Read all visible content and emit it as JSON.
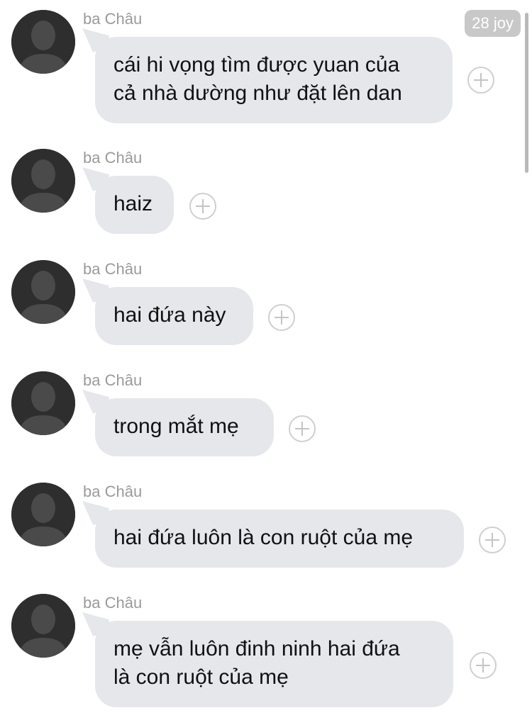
{
  "status": {
    "time_badge": "28 joy"
  },
  "messages": [
    {
      "sender": "ba Châu",
      "text": "cái hi vọng tìm được yuan của\ncả nhà dường như đặt lên dan"
    },
    {
      "sender": "ba Châu",
      "text": "haiz"
    },
    {
      "sender": "ba Châu",
      "text": "hai đứa này"
    },
    {
      "sender": "ba Châu",
      "text": "trong mắt mẹ"
    },
    {
      "sender": "ba Châu",
      "text": "hai đứa luôn là con ruột của mẹ"
    },
    {
      "sender": "ba Châu",
      "text": "mẹ vẫn luôn đinh ninh hai đứa\nlà con ruột của mẹ"
    }
  ],
  "icons": {
    "avatar": "default-person-avatar-icon",
    "react": "add-reaction-plus-icon"
  }
}
